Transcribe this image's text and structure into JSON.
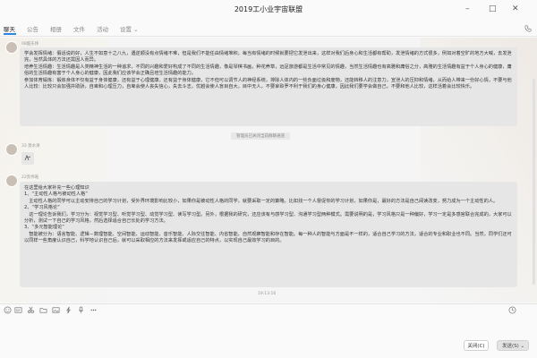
{
  "window": {
    "title": "2019工小业宇宙联盟"
  },
  "tabs": [
    {
      "label": "聊天"
    },
    {
      "label": "公告"
    },
    {
      "label": "相册"
    },
    {
      "label": "文件"
    },
    {
      "label": "活动"
    },
    {
      "label": "设置 ⌄"
    }
  ],
  "messages": {
    "m1": {
      "sender": "08酷乐炜",
      "lines": [
        "学会发挥情绪：假话说的好，人生不如意十之八九，遇逆顺没有点情绪不难，但是我们不能任由情绪堆积，每当有情绪的时候就要把它发泄出来，这样对我们后身心和生活都有帮助，发泄情绪的方式很多，例如对着空旷的地方大喊，去发泄完，当然具体的方法还需因人而异。",
        "培养生活情趣：生活情趣是人类精神生活的一种追求，不同的兴趣和爱好构成了不同的生活情趣，像是琴棋书画，种花养草，远足旅游都是生活中常见的情趣，当然生活情趣也有高雅和庸俗之分，高雅的生活情趣有益于个人身心的健康，庸俗的生活情趣有害于个人身心的健康，因此我们应该学会正确且培生活情趣的能力。",
        "参加体育锻炼：锻炼身体不仅有益于身体健康，还有益于心理健康。还有益于身体健康，它不但可以调节人的神经系统，排除人体内的一些负面垃圾和废物，还能转移人的注意力，宣泄人的压抑和情绪，从而给人带来一份好心情，不要与他人比较：比较只会加强并助骄，自卑和心理压力，自卑会使人丧失信心，失去斗志，优越会使人盲目自大，目中无人，不要拿聆罗不利于我们的身心健康，因此我们要学会做自己，不要和他人比较，这样活着会比较快乐。"
      ]
    },
    "notice": "管理员已关闭当前群聊通道",
    "m2": {
      "sender": "33 莫水清"
    },
    "m3": {
      "sender": "22凯伟皓",
      "lines": [
        "在这里给大家补充一些心理知识",
        "1、“主动性人格与被动性人格”",
        "　主动性人格的同学可以主动安排自己的学习计划，受外界环境影响比较小，如果你是被动性人格的同学，就要采取一定的策略。比如找一个人督促你的学习计划，如果你是，最好的方法是自己阅读改变，努力成为一个主动性的人。",
        "2、“学习风格论”",
        "　这一理论告诉我们，学习分为：视觉学习型、听觉学习型、动觉学习型、读写学习型。另外，根据我的研究，还应该有与感学习型、沟通学习型两种模式。需要说明的是，学习风格只是一种偏好，学习一定是多感官联合完成的，大家可以分析，测试一下自己的学习风格，然后选择适合自己长处的学习方法。",
        "3、“多元智能理论”",
        "　智能被分为：语言智能、逻辑－数理智能、空间智能、运动智能、音乐智能、人际交往智能、内省智能、自然观察智能和存在智能。每一种人的智能与方面是不一样的，适合自己学习的方法，适合的专业和职业也不同。当然，同学们还可以同样一些角度认识自己，科学地认识自己后，就可以采取相应的方法来发挥或适应自己的特点，以实现自己最效学习的目的。"
      ]
    },
    "time": "19:13:16"
  },
  "buttons": {
    "close": "关闭(C)",
    "send": "发送(S) ⌄"
  },
  "icons": [
    "emoji-icon",
    "gif-icon",
    "scissors-icon",
    "folder-icon",
    "image-icon",
    "lightning-icon",
    "microphone-icon",
    "phone-icon",
    "video-icon",
    "history-icon"
  ]
}
